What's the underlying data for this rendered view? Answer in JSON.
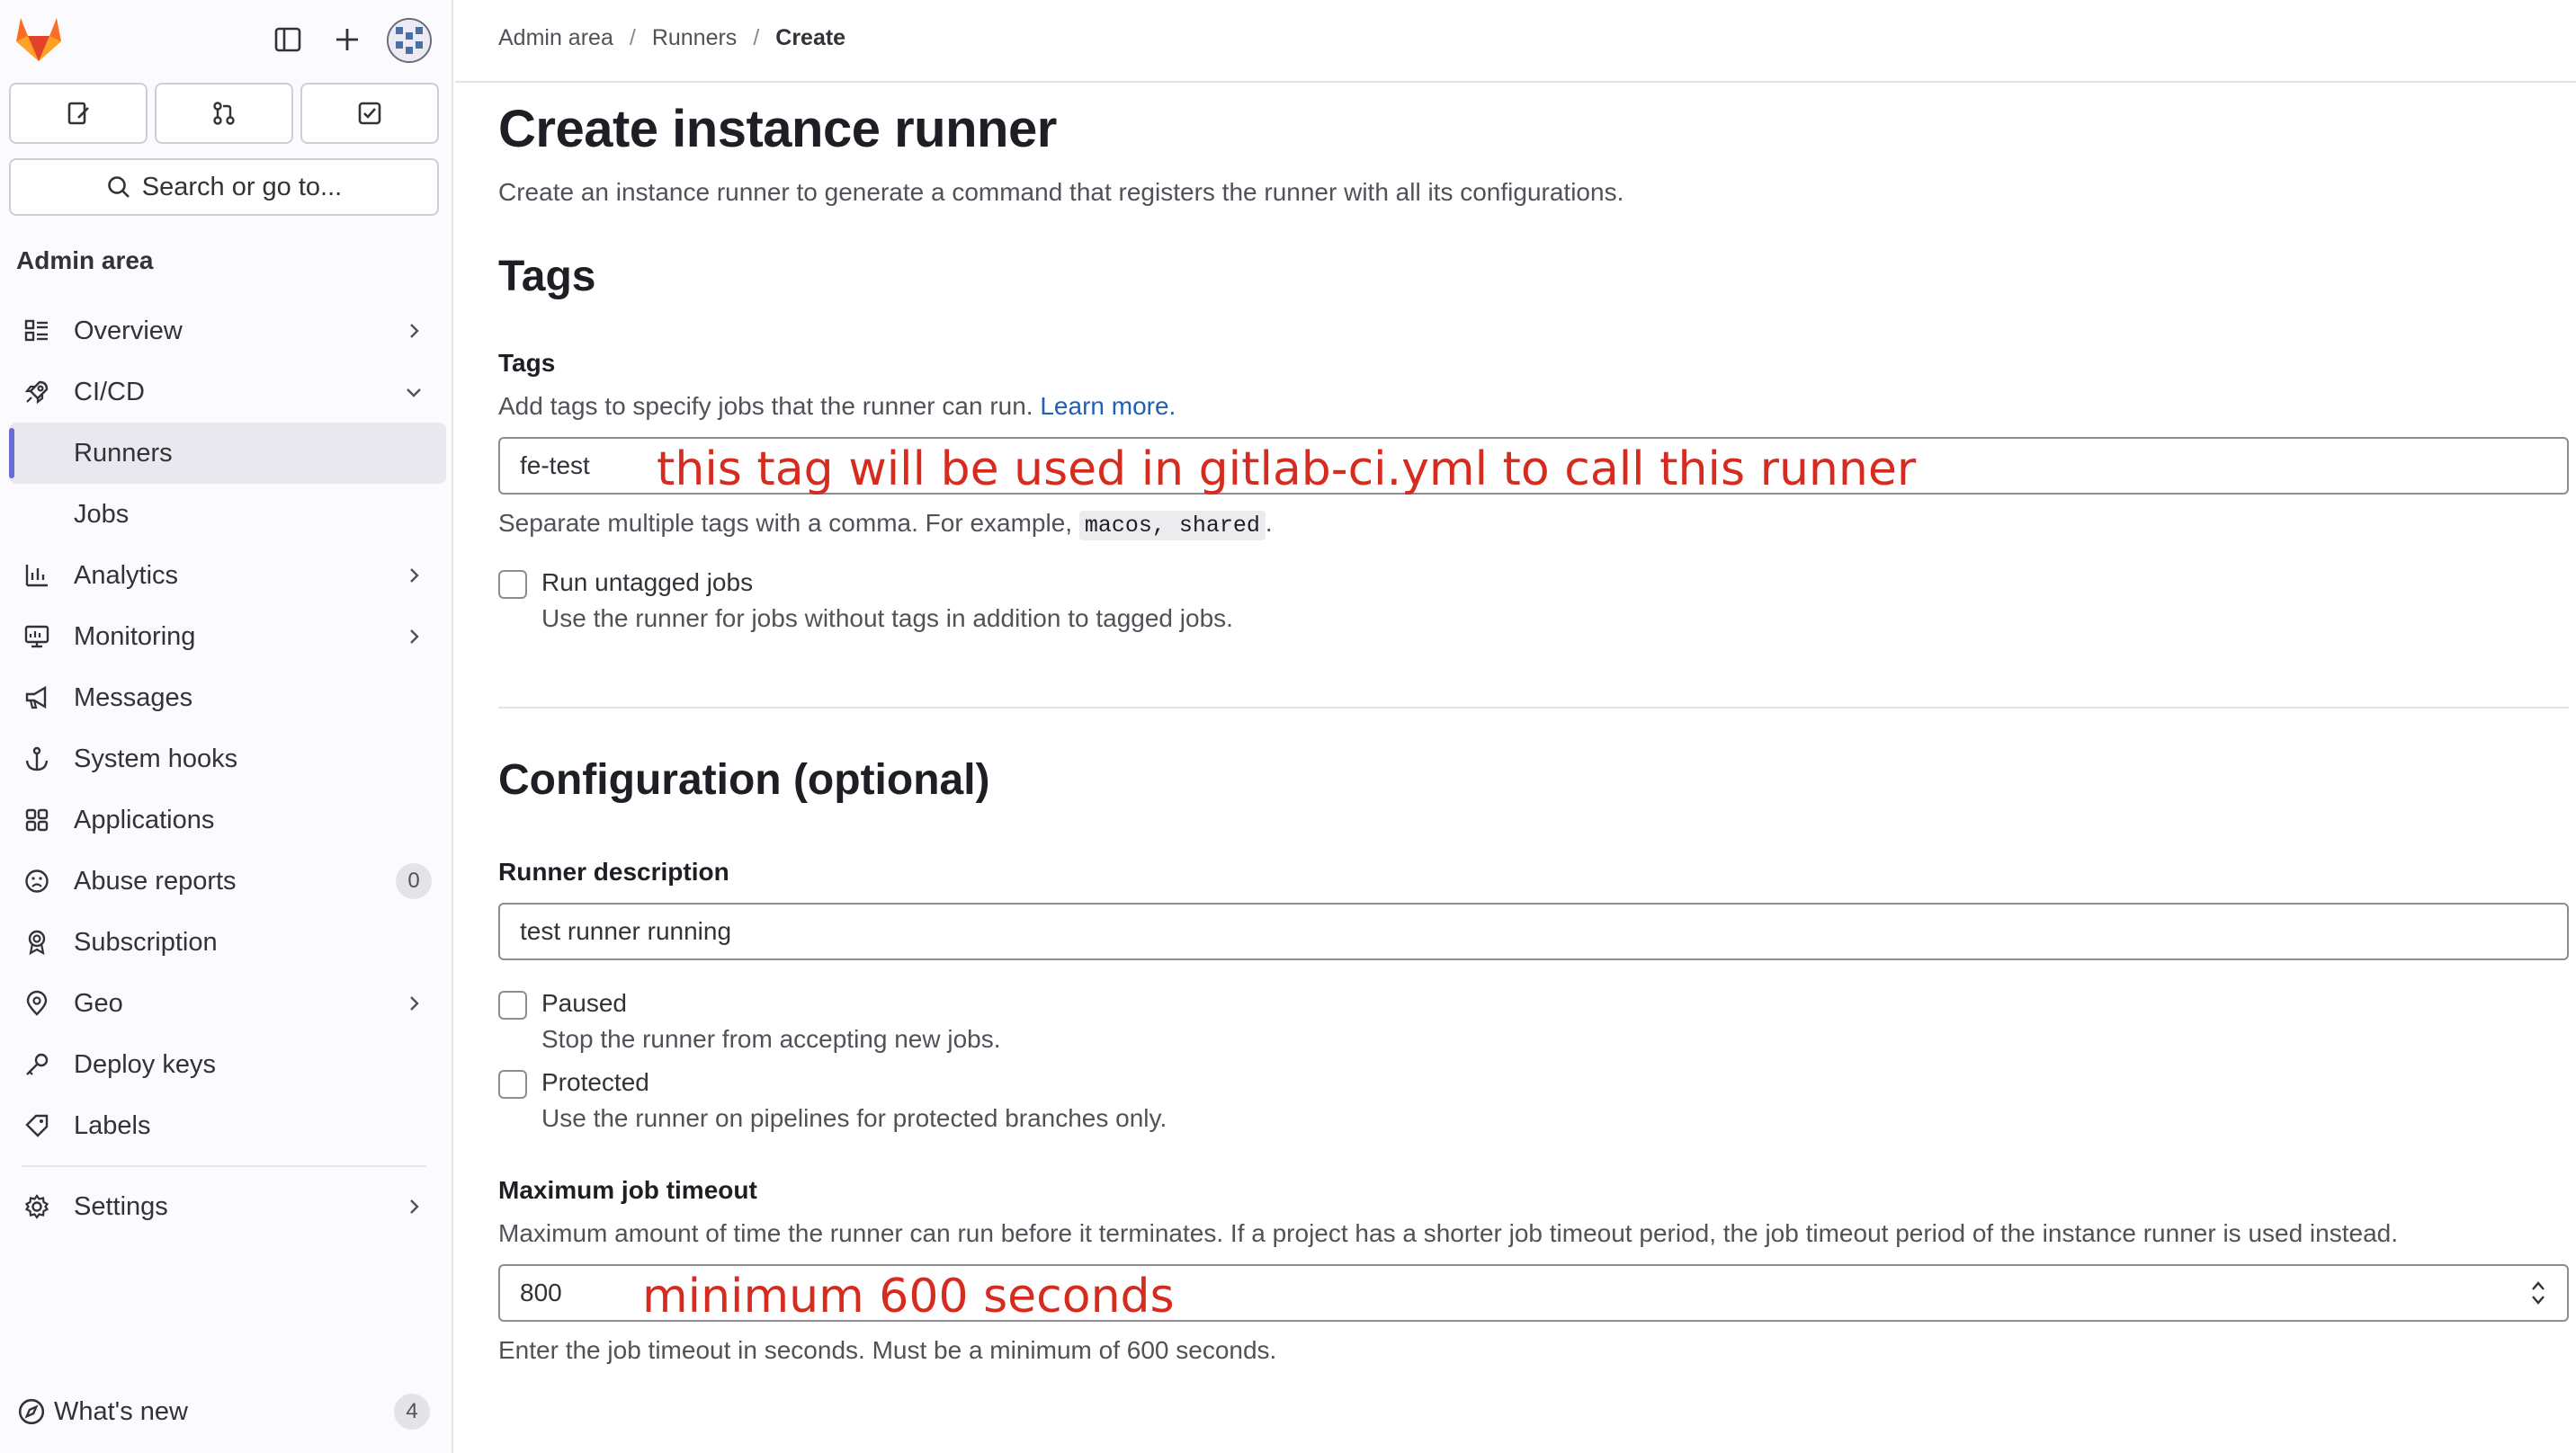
{
  "sidebar": {
    "search_label": "Search or go to...",
    "section_heading": "Admin area",
    "items": [
      {
        "label": "Overview"
      },
      {
        "label": "CI/CD"
      },
      {
        "label": "Runners"
      },
      {
        "label": "Jobs"
      },
      {
        "label": "Analytics"
      },
      {
        "label": "Monitoring"
      },
      {
        "label": "Messages"
      },
      {
        "label": "System hooks"
      },
      {
        "label": "Applications"
      },
      {
        "label": "Abuse reports",
        "badge": "0"
      },
      {
        "label": "Subscription"
      },
      {
        "label": "Geo"
      },
      {
        "label": "Deploy keys"
      },
      {
        "label": "Labels"
      },
      {
        "label": "Settings"
      }
    ],
    "whats_new": {
      "label": "What's new",
      "badge": "4"
    }
  },
  "breadcrumb": {
    "items": [
      "Admin area",
      "Runners",
      "Create"
    ],
    "separator": "/"
  },
  "page": {
    "title": "Create instance runner",
    "description": "Create an instance runner to generate a command that registers the runner with all its configurations."
  },
  "tags_section": {
    "heading": "Tags",
    "field_label": "Tags",
    "help_text": "Add tags to specify jobs that the runner can run.",
    "help_link": "Learn more.",
    "value": "fe-test",
    "hint_prefix": "Separate multiple tags with a comma. For example, ",
    "hint_code": "macos, shared",
    "hint_suffix": ".",
    "run_untagged": {
      "label": "Run untagged jobs",
      "help": "Use the runner for jobs without tags in addition to tagged jobs.",
      "checked": false
    }
  },
  "config_section": {
    "heading": "Configuration (optional)",
    "description_label": "Runner description",
    "description_value": "test runner running",
    "paused": {
      "label": "Paused",
      "help": "Stop the runner from accepting new jobs.",
      "checked": false
    },
    "protected": {
      "label": "Protected",
      "help": "Use the runner on pipelines for protected branches only.",
      "checked": false
    },
    "timeout_label": "Maximum job timeout",
    "timeout_help": "Maximum amount of time the runner can run before it terminates. If a project has a shorter job timeout period, the job timeout period of the instance runner is used instead.",
    "timeout_value": "800",
    "timeout_hint": "Enter the job timeout in seconds. Must be a minimum of 600 seconds."
  },
  "annotations": {
    "tags_note": "this tag will be used in gitlab-ci.yml to call this runner",
    "timeout_note": "minimum 600 seconds"
  },
  "colors": {
    "annotation": "#d62b1f",
    "link": "#1f5fb4",
    "active_indicator": "#6a6cd6"
  }
}
